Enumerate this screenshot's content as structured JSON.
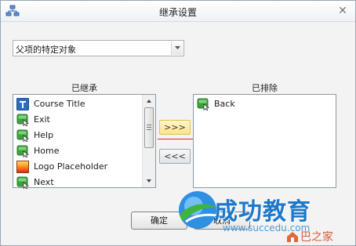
{
  "window": {
    "title": "继承设置",
    "close_glyph": "✕"
  },
  "source_dropdown": {
    "selected": "父项的特定对象"
  },
  "inherited_list": {
    "title": "已继承",
    "items": [
      {
        "label": "Course Title",
        "icon": "title-icon"
      },
      {
        "label": "Exit",
        "icon": "button-icon"
      },
      {
        "label": "Help",
        "icon": "button-icon"
      },
      {
        "label": "Home",
        "icon": "button-icon"
      },
      {
        "label": "Logo Placeholder",
        "icon": "image-placeholder-icon"
      },
      {
        "label": "Next",
        "icon": "button-icon"
      }
    ]
  },
  "excluded_list": {
    "title": "已排除",
    "items": [
      {
        "label": "Back",
        "icon": "button-icon"
      }
    ]
  },
  "move_buttons": {
    "exclude_label": ">>>",
    "include_label": "<<<"
  },
  "footer": {
    "ok_label": "确定",
    "cancel_label": "取消"
  },
  "watermark": {
    "brand": "成功教育",
    "url": "www.succedu.com",
    "badge": "巴之家"
  },
  "colors": {
    "button_icon_green": "#3aa33a",
    "title_icon_blue": "#2a6ebd",
    "active_button": "#ffe38a",
    "separator_red": "#d62828"
  }
}
